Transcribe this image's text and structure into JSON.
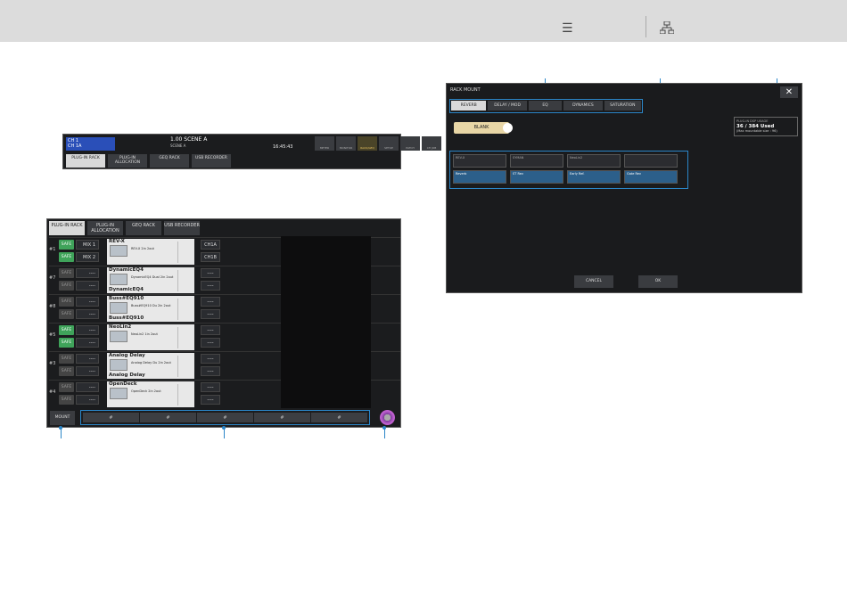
{
  "header": {
    "icon_list": "list-icon",
    "icon_tree": "sitemap-icon"
  },
  "toolbar": {
    "channel_id": "CH 1",
    "channel_name": "CH 1A",
    "scene": "1.00 SCENE A",
    "scene_sub": "SCENE A",
    "time": "16:45:43",
    "buttons": [
      "METER",
      "MONITOR",
      "RACK/GEQ",
      "SETUP",
      "PATCH",
      "CH JOB"
    ],
    "tabs": [
      {
        "label": "PLUG-IN RACK"
      },
      {
        "label": "PLUG-IN ALLOCATION"
      },
      {
        "label": "GEQ RACK"
      },
      {
        "label": "USB RECORDER"
      }
    ]
  },
  "rack": {
    "tabs": [
      {
        "label": "PLUG-IN RACK"
      },
      {
        "label": "PLUG-IN ALLOCATION"
      },
      {
        "label": "GEQ RACK"
      },
      {
        "label": "USB RECORDER"
      }
    ],
    "rows": [
      {
        "num": "#1",
        "safe1": "SAFE",
        "safe2": "SAFE",
        "in1": "MIX 1",
        "in2": "MIX 2",
        "name": "REV-X",
        "name2": "",
        "desc": "REV-X 2in 2out",
        "out1": "CH1A",
        "out2": "CH1B",
        "on": true
      },
      {
        "num": "#7",
        "safe1": "SAFE",
        "safe2": "SAFE",
        "in1": "----",
        "in2": "----",
        "name": "DynamicEQ4",
        "name2": "DynamicEQ4",
        "desc": "DynamicEQ4 Dual 2in 2out",
        "out1": "----",
        "out2": "----",
        "on": false
      },
      {
        "num": "#8",
        "safe1": "SAFE",
        "safe2": "SAFE",
        "in1": "----",
        "in2": "----",
        "name": "Buss#EQ910",
        "name2": "Buss#EQ910",
        "desc": "Buss#EQ910 Du 2in 2out",
        "out1": "----",
        "out2": "----",
        "on": false
      },
      {
        "num": "#5",
        "safe1": "SAFE",
        "safe2": "SAFE",
        "in1": "----",
        "in2": "----",
        "name": "NeoLin2",
        "name2": "",
        "desc": "NeoLin2 1in 2out",
        "out1": "----",
        "out2": "----",
        "on": true
      },
      {
        "num": "#3",
        "safe1": "SAFE",
        "safe2": "SAFE",
        "in1": "----",
        "in2": "----",
        "name": "Analog Delay",
        "name2": "Analog Delay",
        "desc": "Analog Delay Du 2in 2out",
        "out1": "----",
        "out2": "----",
        "on": false
      },
      {
        "num": "#4",
        "safe1": "SAFE",
        "safe2": "SAFE",
        "in1": "----",
        "in2": "----",
        "name": "OpenDeck",
        "name2": "",
        "desc": "OpenDeck 2in 2out",
        "out1": "----",
        "out2": "----",
        "on": false
      }
    ],
    "mount_label": "MOUNT",
    "pages": [
      "#",
      "#",
      "#",
      "#",
      "#"
    ]
  },
  "dialog": {
    "title": "RACK MOUNT",
    "close": "✕",
    "tabs": [
      {
        "label": "REVERB",
        "active": true
      },
      {
        "label": "DELAY / MOD",
        "active": false
      },
      {
        "label": "EQ",
        "active": false
      },
      {
        "label": "DYNAMICS",
        "active": false
      },
      {
        "label": "SATURATION",
        "active": false
      }
    ],
    "blank_label": "BLANK",
    "dsp": {
      "caption": "PLUG-IN DSP USAGE",
      "value": "36 / 384 Used",
      "sub": "(Max mountable size : 96)"
    },
    "plugins": [
      {
        "label": "REV-X",
        "spx": false
      },
      {
        "label": "SYMAN",
        "spx": false
      },
      {
        "label": "NeoLin2",
        "spx": false
      },
      {
        "label": "",
        "spx": false
      },
      {
        "label": "Reverb",
        "spx": true
      },
      {
        "label": "ST Rev",
        "spx": true
      },
      {
        "label": "Early Ref.",
        "spx": true
      },
      {
        "label": "Gate Rev",
        "spx": true
      }
    ],
    "cancel_label": "CANCEL",
    "ok_label": "OK"
  }
}
